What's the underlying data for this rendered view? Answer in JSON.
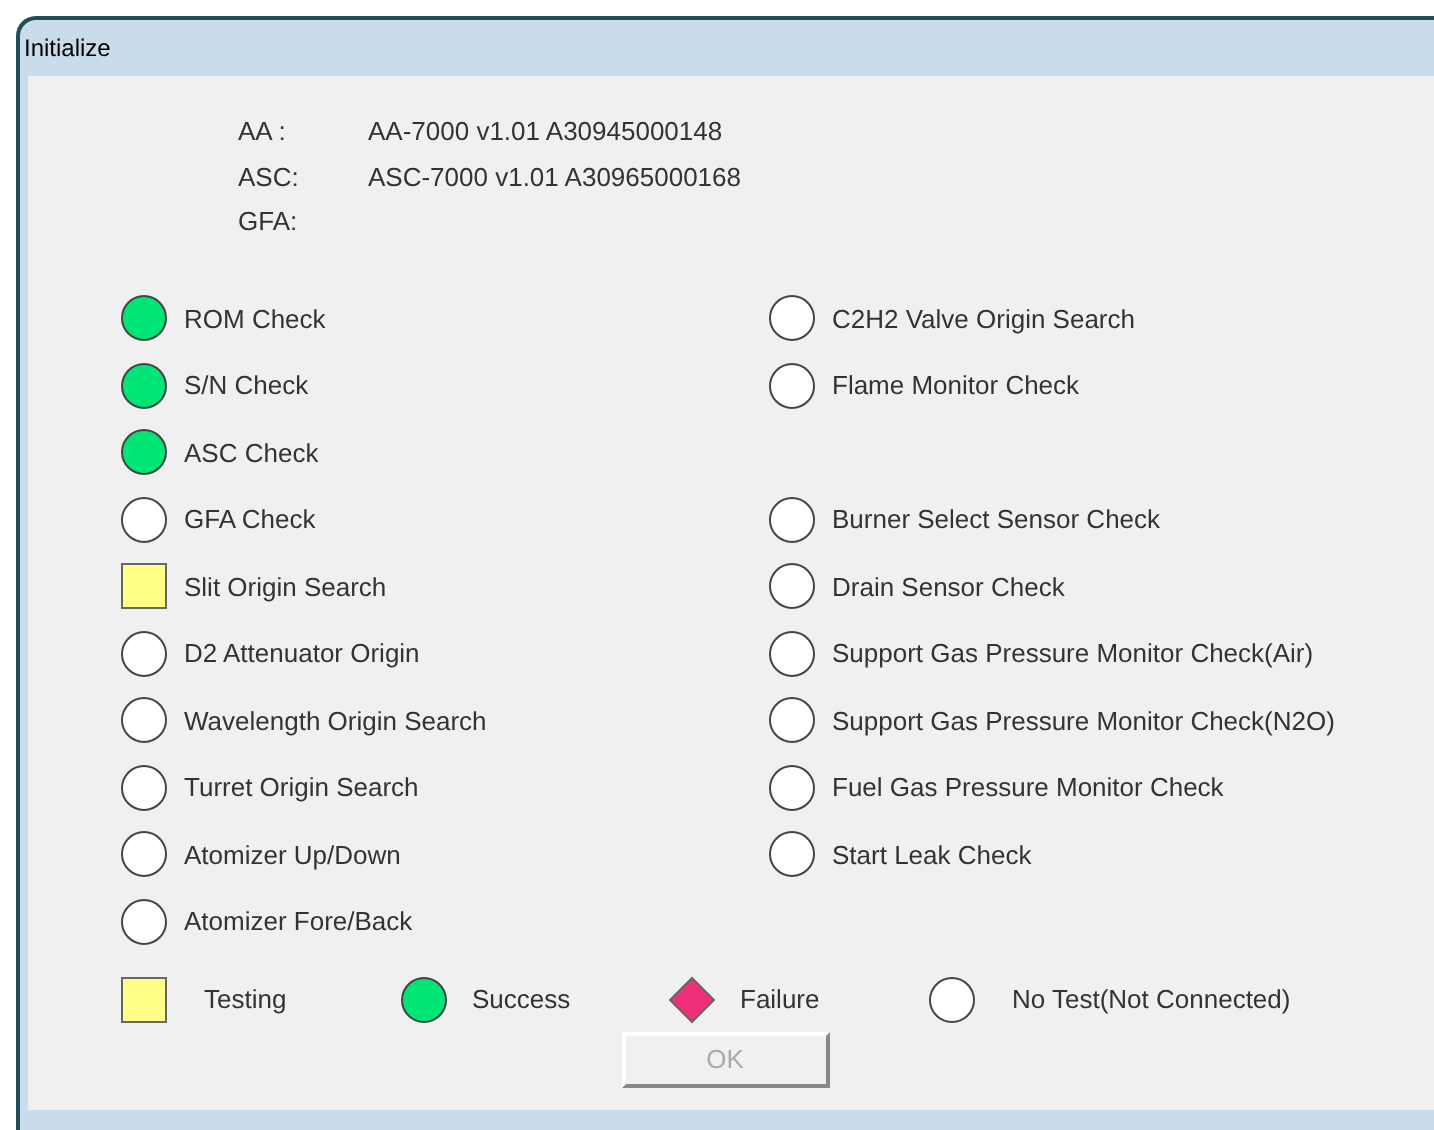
{
  "window": {
    "title": "Initialize"
  },
  "info": [
    {
      "label": "AA :",
      "value": "AA-7000 v1.01 A30945000148"
    },
    {
      "label": "ASC:",
      "value": "ASC-7000 v1.01 A30965000168"
    },
    {
      "label": "GFA:"
    }
  ],
  "rows": [
    {
      "left": {
        "label": "ROM Check",
        "kind": "success"
      },
      "right": {
        "label": "C2H2 Valve Origin Search",
        "kind": "none"
      }
    },
    {
      "left": {
        "label": "S/N Check",
        "kind": "success"
      },
      "right": {
        "label": "Flame Monitor Check",
        "kind": "none"
      }
    },
    {
      "left": {
        "label": "ASC Check",
        "kind": "success"
      }
    },
    {
      "left": {
        "label": "GFA Check",
        "kind": "none"
      },
      "right": {
        "label": "Burner Select Sensor Check",
        "kind": "none"
      }
    },
    {
      "left": {
        "label": "Slit Origin Search",
        "kind": "testing"
      },
      "right": {
        "label": "Drain Sensor Check",
        "kind": "none"
      }
    },
    {
      "left": {
        "label": "D2 Attenuator Origin",
        "kind": "none"
      },
      "right": {
        "label": "Support Gas Pressure Monitor Check(Air)",
        "kind": "none"
      }
    },
    {
      "left": {
        "label": "Wavelength Origin Search",
        "kind": "none"
      },
      "right": {
        "label": "Support Gas Pressure Monitor Check(N2O)",
        "kind": "none"
      }
    },
    {
      "left": {
        "label": "Turret Origin Search",
        "kind": "none"
      },
      "right": {
        "label": "Fuel Gas Pressure Monitor Check",
        "kind": "none"
      }
    },
    {
      "left": {
        "label": "Atomizer Up/Down",
        "kind": "none"
      },
      "right": {
        "label": "Start Leak Check",
        "kind": "none"
      }
    },
    {
      "left": {
        "label": "Atomizer Fore/Back",
        "kind": "none"
      }
    }
  ],
  "legend": [
    {
      "kind": "testing",
      "label": "Testing"
    },
    {
      "kind": "success",
      "label": "Success"
    },
    {
      "kind": "failure",
      "label": "Failure"
    },
    {
      "kind": "none",
      "label": "No Test(Not Connected)"
    }
  ],
  "ok_button": {
    "label": "OK",
    "disabled": true
  }
}
